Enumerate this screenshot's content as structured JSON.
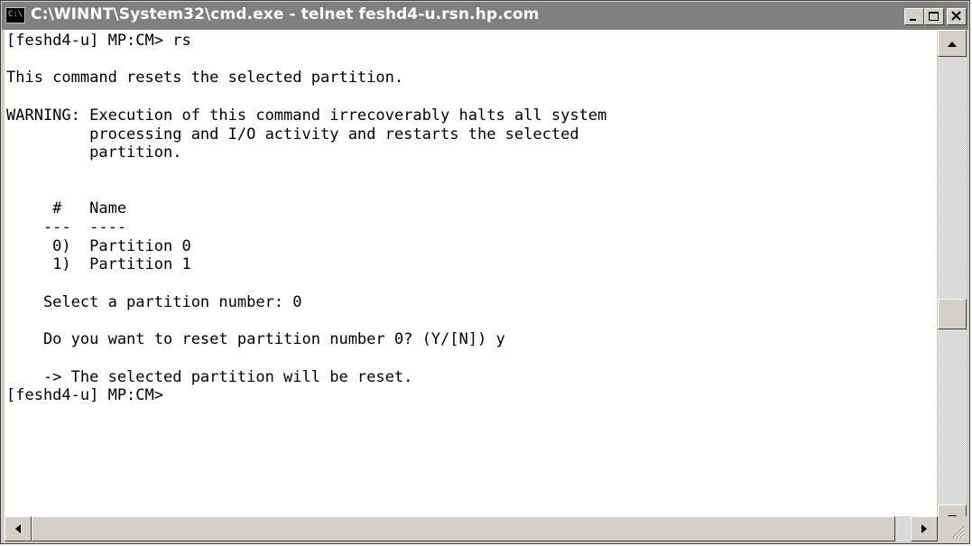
{
  "window": {
    "title": "C:\\WINNT\\System32\\cmd.exe - telnet feshd4-u.rsn.hp.com",
    "icon": "C:\\",
    "controls": [
      "minimize-icon",
      "maximize-icon",
      "close-icon"
    ]
  },
  "console": {
    "lines": [
      "[feshd4-u] MP:CM> rs",
      "",
      "This command resets the selected partition.",
      "",
      "WARNING: Execution of this command irrecoverably halts all system",
      "         processing and I/O activity and restarts the selected",
      "         partition.",
      "",
      "",
      "     #   Name",
      "    ---  ----",
      "     0)  Partition 0",
      "     1)  Partition 1",
      "",
      "    Select a partition number: 0",
      "",
      "    Do you want to reset partition number 0? (Y/[N]) y",
      "",
      "    -> The selected partition will be reset.",
      "[feshd4-u] MP:CM>"
    ]
  }
}
